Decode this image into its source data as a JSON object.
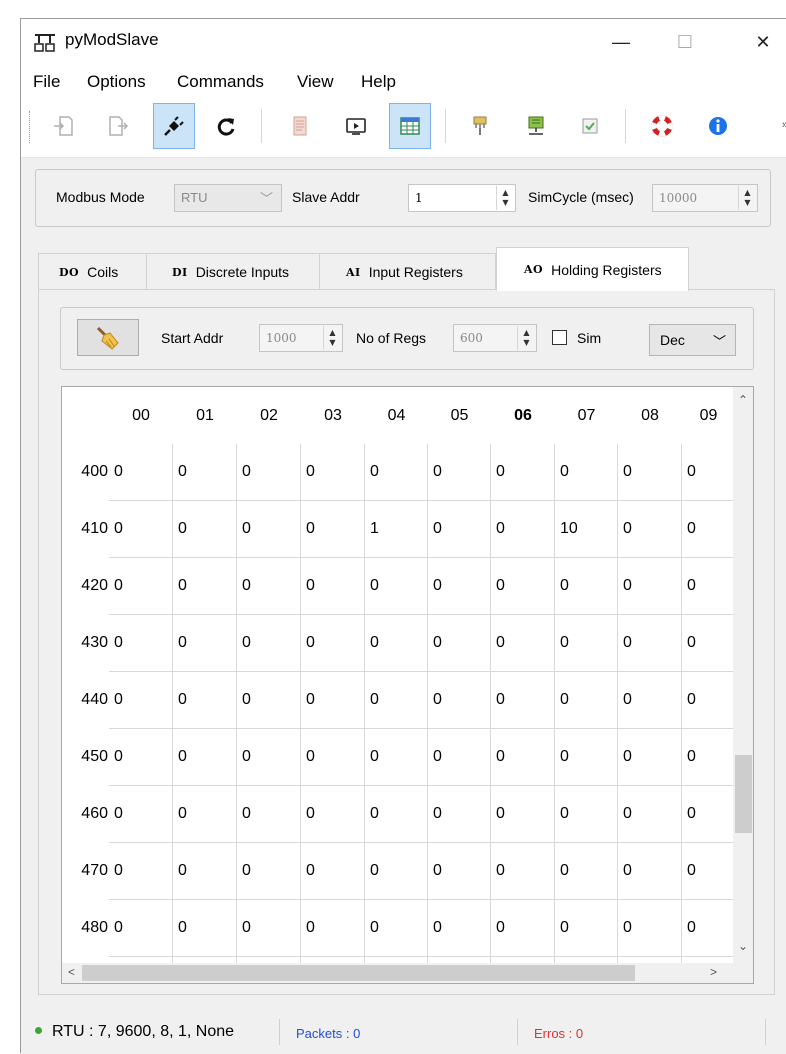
{
  "window": {
    "title": "pyModSlave",
    "minimize": "—",
    "maximize": "☐",
    "close": "✕"
  },
  "menu": [
    "File",
    "Options",
    "Commands",
    "View",
    "Help"
  ],
  "toolbar_icons": [
    "load-icon",
    "save-icon",
    "connect-icon",
    "reset-icon",
    "log-icon",
    "bus-monitor-icon",
    "registers-icon",
    "serial-settings-icon",
    "tcp-settings-icon",
    "settings-icon",
    "help-icon",
    "about-icon"
  ],
  "modbus": {
    "mode_label": "Modbus Mode",
    "mode_value": "RTU",
    "slave_label": "Slave Addr",
    "slave_value": "1",
    "simcycle_label": "SimCycle (msec)",
    "simcycle_value": "10000"
  },
  "tabs": [
    {
      "icon": "DO",
      "label": "Coils"
    },
    {
      "icon": "DI",
      "label": "Discrete Inputs"
    },
    {
      "icon": "AI",
      "label": "Input Registers"
    },
    {
      "icon": "AO",
      "label": "Holding Registers"
    }
  ],
  "controls": {
    "start_label": "Start Addr",
    "start_value": "1000",
    "regs_label": "No of Regs",
    "regs_value": "600",
    "sim_label": "Sim",
    "format_value": "Dec"
  },
  "grid": {
    "columns": [
      "00",
      "01",
      "02",
      "03",
      "04",
      "05",
      "06",
      "07",
      "08",
      "09"
    ],
    "rows": [
      {
        "label": "400",
        "values": [
          "0",
          "0",
          "0",
          "0",
          "0",
          "0",
          "0",
          "0",
          "0",
          "0"
        ]
      },
      {
        "label": "410",
        "values": [
          "0",
          "0",
          "0",
          "0",
          "1",
          "0",
          "0",
          "10",
          "0",
          "0"
        ]
      },
      {
        "label": "420",
        "values": [
          "0",
          "0",
          "0",
          "0",
          "0",
          "0",
          "0",
          "0",
          "0",
          "0"
        ]
      },
      {
        "label": "430",
        "values": [
          "0",
          "0",
          "0",
          "0",
          "0",
          "0",
          "0",
          "0",
          "0",
          "0"
        ]
      },
      {
        "label": "440",
        "values": [
          "0",
          "0",
          "0",
          "0",
          "0",
          "0",
          "0",
          "0",
          "0",
          "0"
        ]
      },
      {
        "label": "450",
        "values": [
          "0",
          "0",
          "0",
          "0",
          "0",
          "0",
          "0",
          "0",
          "0",
          "0"
        ]
      },
      {
        "label": "460",
        "values": [
          "0",
          "0",
          "0",
          "0",
          "0",
          "0",
          "0",
          "0",
          "0",
          "0"
        ]
      },
      {
        "label": "470",
        "values": [
          "0",
          "0",
          "0",
          "0",
          "0",
          "0",
          "0",
          "0",
          "0",
          "0"
        ]
      },
      {
        "label": "480",
        "values": [
          "0",
          "0",
          "0",
          "0",
          "0",
          "0",
          "0",
          "0",
          "0",
          "0"
        ]
      }
    ]
  },
  "status": {
    "connection": "RTU : 7, 9600, 8, 1, None",
    "packets": "Packets : 0",
    "errors": "Erros : 0"
  },
  "colors": {
    "accent": "#cce4f7",
    "packets": "#1f4fd8",
    "errors": "#e53030",
    "status_ok": "#3aa63a"
  }
}
